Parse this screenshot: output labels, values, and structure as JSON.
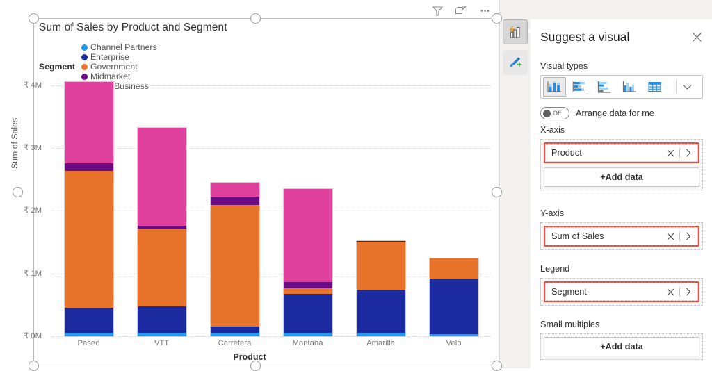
{
  "visual_toolbar": [
    {
      "name": "filter-icon",
      "label": "Filters"
    },
    {
      "name": "focus-mode-icon",
      "label": "Focus mode"
    },
    {
      "name": "more-options-icon",
      "label": "More options"
    }
  ],
  "chart": {
    "title": "Sum of Sales by Product and Segment",
    "legend_title": "Segment",
    "xaxis_title": "Product",
    "yaxis_title": "Sum of Sales"
  },
  "chart_data": {
    "type": "bar",
    "subtype": "stacked-column",
    "title": "Sum of Sales by Product and Segment",
    "xlabel": "Product",
    "ylabel": "Sum of Sales",
    "categories": [
      "Paseo",
      "VTT",
      "Carretera",
      "Montana",
      "Amarilla",
      "Velo"
    ],
    "ylim": [
      0,
      4050000
    ],
    "ytick_values": [
      0,
      1000000,
      2000000,
      3000000,
      4000000
    ],
    "ytick_labels": [
      "₹ 0M",
      "₹ 1M",
      "₹ 2M",
      "₹ 3M",
      "₹ 4M"
    ],
    "currency_symbol": "₹",
    "grid": true,
    "legend_position": "top",
    "series": [
      {
        "name": "Channel Partners",
        "color": "#1f9bf0",
        "values": [
          60000,
          55000,
          60000,
          60000,
          50000,
          35000
        ]
      },
      {
        "name": "Enterprise",
        "color": "#1b2a9e",
        "values": [
          390000,
          420000,
          90000,
          620000,
          690000,
          880000
        ]
      },
      {
        "name": "Government",
        "color": "#e8742c",
        "values": [
          2180000,
          1240000,
          1940000,
          80000,
          760000,
          330000
        ]
      },
      {
        "name": "Midmarket",
        "color": "#6b0b84",
        "values": [
          130000,
          40000,
          130000,
          100000,
          20000,
          0
        ]
      },
      {
        "name": "Small Business",
        "color": "#e0419e",
        "values": [
          1290000,
          1560000,
          230000,
          1490000,
          0,
          0
        ]
      }
    ]
  },
  "pane": {
    "rail": [
      {
        "name": "suggest-visual-icon",
        "label": "Suggest a visual",
        "active": true
      },
      {
        "name": "format-visual-icon",
        "label": "Format visual",
        "active": false
      }
    ],
    "title": "Suggest a visual",
    "close_label": "Close",
    "visual_types_label": "Visual types",
    "visual_types": [
      {
        "name": "stacked-column-chart-icon",
        "label": "Stacked column chart",
        "selected": true
      },
      {
        "name": "stacked-bar-chart-icon",
        "label": "Stacked bar chart",
        "selected": false
      },
      {
        "name": "clustered-bar-chart-icon",
        "label": "Clustered bar chart",
        "selected": false
      },
      {
        "name": "clustered-column-chart-icon",
        "label": "Clustered column chart",
        "selected": false
      },
      {
        "name": "table-icon",
        "label": "Table",
        "selected": false
      }
    ],
    "visual_types_more_label": "More visual types",
    "toggle": {
      "state": "Off",
      "label": "Arrange data for me"
    },
    "wells": [
      {
        "section": "X-axis",
        "chip": "Product",
        "highlighted": true,
        "add": "+Add data"
      },
      {
        "section": "Y-axis",
        "chip": "Sum of Sales",
        "highlighted": true,
        "add": null
      },
      {
        "section": "Legend",
        "chip": "Segment",
        "highlighted": true,
        "add": null
      },
      {
        "section": "Small multiples",
        "chip": null,
        "highlighted": false,
        "add": "+Add data"
      }
    ],
    "highlight_color": "#e8564a"
  }
}
